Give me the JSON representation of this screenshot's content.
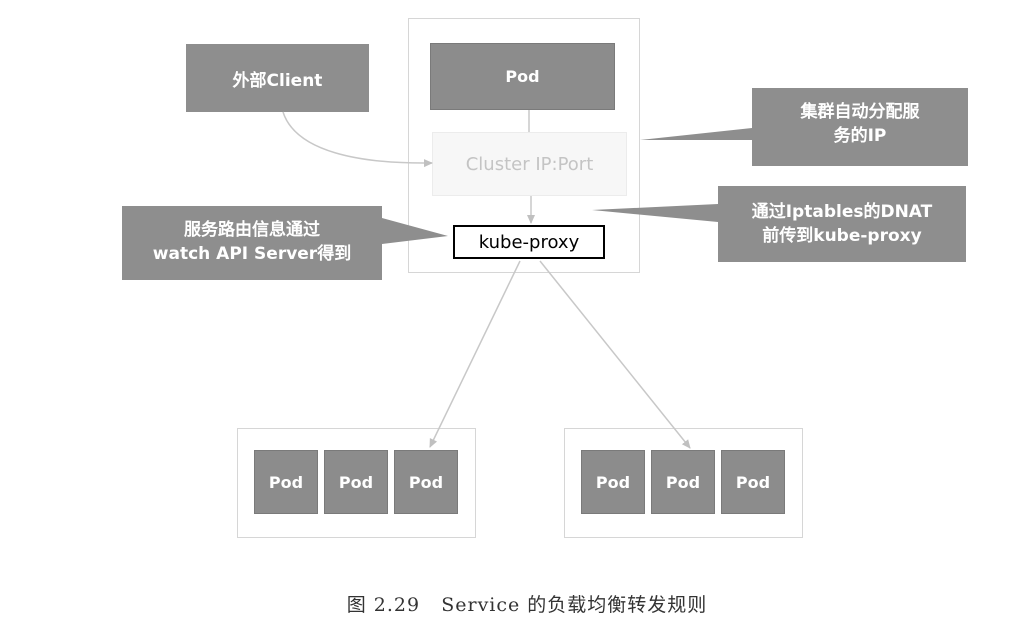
{
  "diagram": {
    "top_pod": "Pod",
    "cluster_ip": "Cluster IP:Port",
    "kube_proxy": "kube-proxy",
    "client": "外部Client",
    "callout_cluster_ip": [
      "集群自动分配服",
      "务的IP"
    ],
    "callout_iptables": [
      "通过Iptables的DNAT",
      "前传到kube-proxy"
    ],
    "callout_routing": [
      "服务路由信息通过",
      "watch API Server得到"
    ],
    "left_group_pods": [
      "Pod",
      "Pod",
      "Pod"
    ],
    "right_group_pods": [
      "Pod",
      "Pod",
      "Pod"
    ],
    "caption": "图 2.29   Service 的负载均衡转发规则"
  },
  "colors": {
    "box_gray": "#8e8e8e",
    "pod_gray": "#8c8c8c",
    "arrow_gray": "#c8c8c8",
    "frame_border": "#d6d6d6"
  }
}
